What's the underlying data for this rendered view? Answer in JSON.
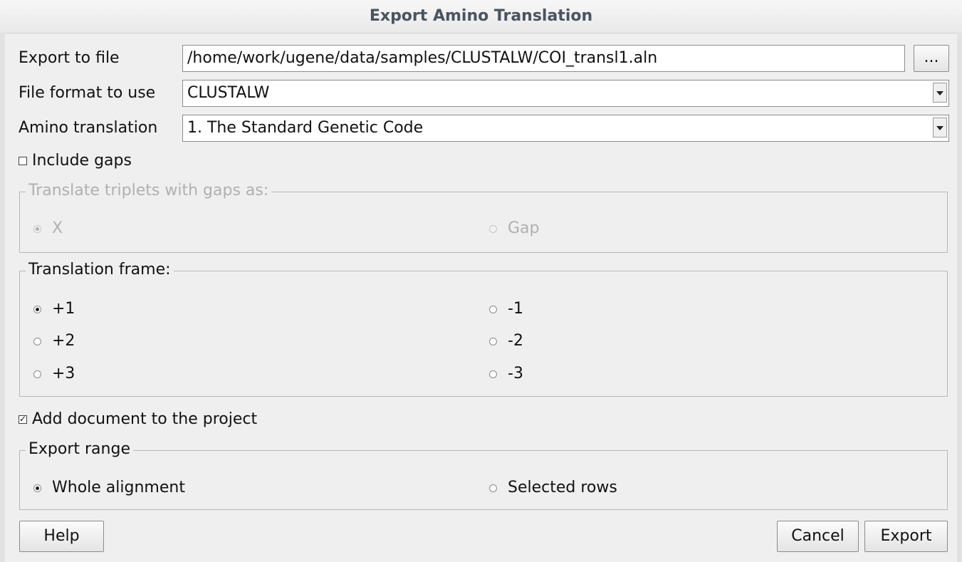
{
  "window": {
    "title": "Export Amino Translation"
  },
  "export_file": {
    "label": "Export to file",
    "value": "/home/work/ugene/data/samples/CLUSTALW/COI_transl1.aln",
    "browse_label": "..."
  },
  "file_format": {
    "label": "File format to use",
    "value": "CLUSTALW"
  },
  "amino_translation": {
    "label": "Amino translation",
    "value": "1. The Standard Genetic Code"
  },
  "include_gaps": {
    "label": "Include gaps",
    "checked": false
  },
  "gap_translation": {
    "legend": "Translate triplets with gaps as:",
    "options": [
      {
        "label": "X",
        "selected": true
      },
      {
        "label": "Gap",
        "selected": false
      }
    ],
    "enabled": false
  },
  "translation_frame": {
    "legend": "Translation frame:",
    "options": [
      {
        "label": "+1",
        "selected": true
      },
      {
        "label": "+2",
        "selected": false
      },
      {
        "label": "+3",
        "selected": false
      },
      {
        "label": "-1",
        "selected": false
      },
      {
        "label": "-2",
        "selected": false
      },
      {
        "label": "-3",
        "selected": false
      }
    ]
  },
  "add_to_project": {
    "label": "Add document to the project",
    "checked": true
  },
  "export_range": {
    "legend": "Export range",
    "options": [
      {
        "label": "Whole alignment",
        "selected": true
      },
      {
        "label": "Selected rows",
        "selected": false
      }
    ]
  },
  "buttons": {
    "help": "Help",
    "cancel": "Cancel",
    "export": "Export"
  }
}
